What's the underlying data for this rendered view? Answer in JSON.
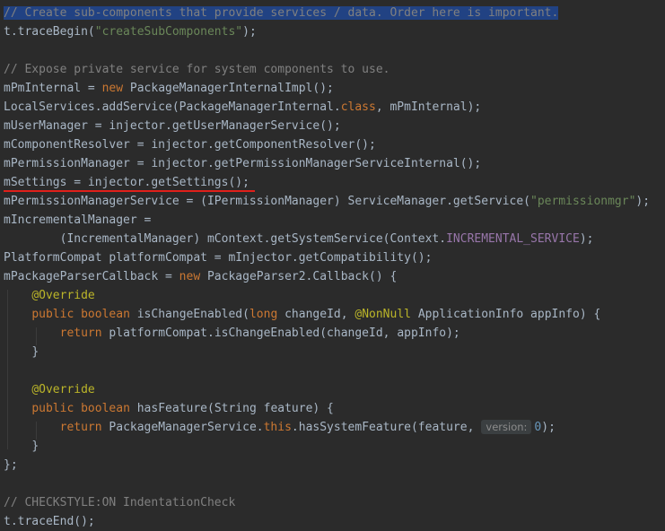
{
  "editor": {
    "comment_create": "// Create sub-components that provide services / data. Order here is important.",
    "trace_begin_prefix": "t.traceBegin(",
    "trace_begin_string": "\"createSubComponents\"",
    "close_paren_semi": ");",
    "comment_expose": "// Expose private service for system components to use.",
    "line_pm_internal_1": "mPmInternal = ",
    "kw_new": "new",
    "line_pm_internal_2": " PackageManagerInternalImpl();",
    "line_local_1": "LocalServices.addService(PackageManagerInternal.",
    "kw_class": "class",
    "line_local_2": ", mPmInternal);",
    "line_user_manager": "mUserManager = injector.getUserManagerService();",
    "line_component_resolver": "mComponentResolver = injector.getComponentResolver();",
    "line_permission_manager": "mPermissionManager = injector.getPermissionManagerServiceInternal();",
    "line_settings": "mSettings = injector.getSettings();",
    "line_perm_service_1": "mPermissionManagerService = (IPermissionManager) ServiceManager.getService(",
    "line_perm_service_string": "\"permissionmgr\"",
    "line_incremental_1": "mIncrementalManager =",
    "line_incremental_2": "        (IncrementalManager) mContext.getSystemService(Context.",
    "field_incremental_service": "INCREMENTAL_SERVICE",
    "line_platform_compat": "PlatformCompat platformCompat = mInjector.getCompatibility();",
    "line_parser_cb_1": "mPackageParserCallback = ",
    "line_parser_cb_2": " PackageParser2.Callback() {",
    "annotation_override": "@Override",
    "kw_public": "public",
    "kw_boolean": "boolean",
    "method_is_change_enabled_1": " isChangeEnabled(",
    "kw_long": "long",
    "method_is_change_enabled_2": " changeId, ",
    "annotation_nonnull": "@NonNull",
    "method_is_change_enabled_3": " ApplicationInfo appInfo) {",
    "kw_return": "return",
    "line_return_change": " platformCompat.isChangeEnabled(changeId, appInfo);",
    "close_brace": "}",
    "method_has_feature": " hasFeature(String feature) {",
    "line_return_feature_1": " PackageManagerService.",
    "kw_this": "this",
    "line_return_feature_2": ".hasSystemFeature(feature,",
    "hint_version": "version:",
    "num_zero": "0",
    "close_brace_semi": "};",
    "comment_checkstyle": "// CHECKSTYLE:ON IndentationCheck",
    "line_trace_end": "t.traceEnd();"
  }
}
